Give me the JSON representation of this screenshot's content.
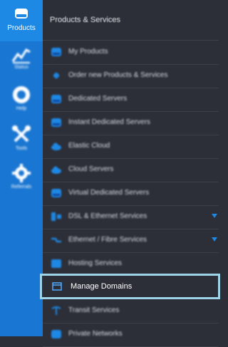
{
  "rail": {
    "items": [
      {
        "label": "Products",
        "icon": "server-icon"
      },
      {
        "label": "Status",
        "icon": "chart-icon"
      },
      {
        "label": "Help",
        "icon": "lifebuoy-icon"
      },
      {
        "label": "Tools",
        "icon": "tools-icon"
      },
      {
        "label": "Referrals",
        "icon": "gear-icon"
      }
    ]
  },
  "panel": {
    "title": "Products & Services",
    "items": [
      {
        "label": "My Products",
        "icon": "server-icon"
      },
      {
        "label": "Order new Products & Services",
        "icon": "plus-icon"
      },
      {
        "label": "Dedicated Servers",
        "icon": "server-icon"
      },
      {
        "label": "Instant Dedicated Servers",
        "icon": "server-icon"
      },
      {
        "label": "Elastic Cloud",
        "icon": "cloud-icon"
      },
      {
        "label": "Cloud Servers",
        "icon": "cloud-icon"
      },
      {
        "label": "Virtual Dedicated Servers",
        "icon": "server-icon"
      },
      {
        "label": "DSL & Ethernet Services",
        "icon": "network-icon"
      },
      {
        "label": "Ethernet / Fibre Services",
        "icon": "fibre-icon"
      },
      {
        "label": "Hosting Services",
        "icon": "hosting-icon"
      },
      {
        "label": "Manage Domains",
        "icon": "window-icon"
      },
      {
        "label": "Transit Services",
        "icon": "antenna-icon"
      },
      {
        "label": "Private Networks",
        "icon": "network-icon"
      }
    ]
  },
  "colors": {
    "rail": "#1976d2",
    "panel": "#2c2f38",
    "highlight_border": "#9fd4e8",
    "accent": "#1e88e5"
  }
}
